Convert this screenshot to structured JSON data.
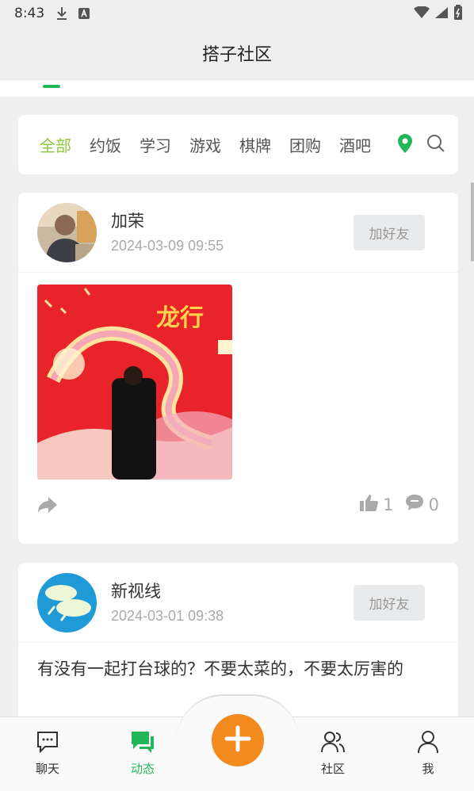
{
  "status_bar": {
    "time": "8:43"
  },
  "header": {
    "title": "搭子社区"
  },
  "categories": [
    {
      "label": "全部",
      "active": true
    },
    {
      "label": "约饭",
      "active": false
    },
    {
      "label": "学习",
      "active": false
    },
    {
      "label": "游戏",
      "active": false
    },
    {
      "label": "棋牌",
      "active": false
    },
    {
      "label": "团购",
      "active": false
    },
    {
      "label": "酒吧",
      "active": false
    }
  ],
  "posts": [
    {
      "user": "加荣",
      "time": "2024-03-09 09:55",
      "add_friend_label": "加好友",
      "image_text": "龙行",
      "likes": "1",
      "comments": "0"
    },
    {
      "user": "新视线",
      "time": "2024-03-01 09:38",
      "add_friend_label": "加好友",
      "text": "有没有一起打台球的？不要太菜的，不要太厉害的"
    }
  ],
  "bottom_nav": {
    "chat": "聊天",
    "feed": "动态",
    "community": "社区",
    "me": "我"
  },
  "colors": {
    "accent": "#21b65a",
    "category_active": "#8dc63f",
    "fab": "#f28a1f"
  }
}
